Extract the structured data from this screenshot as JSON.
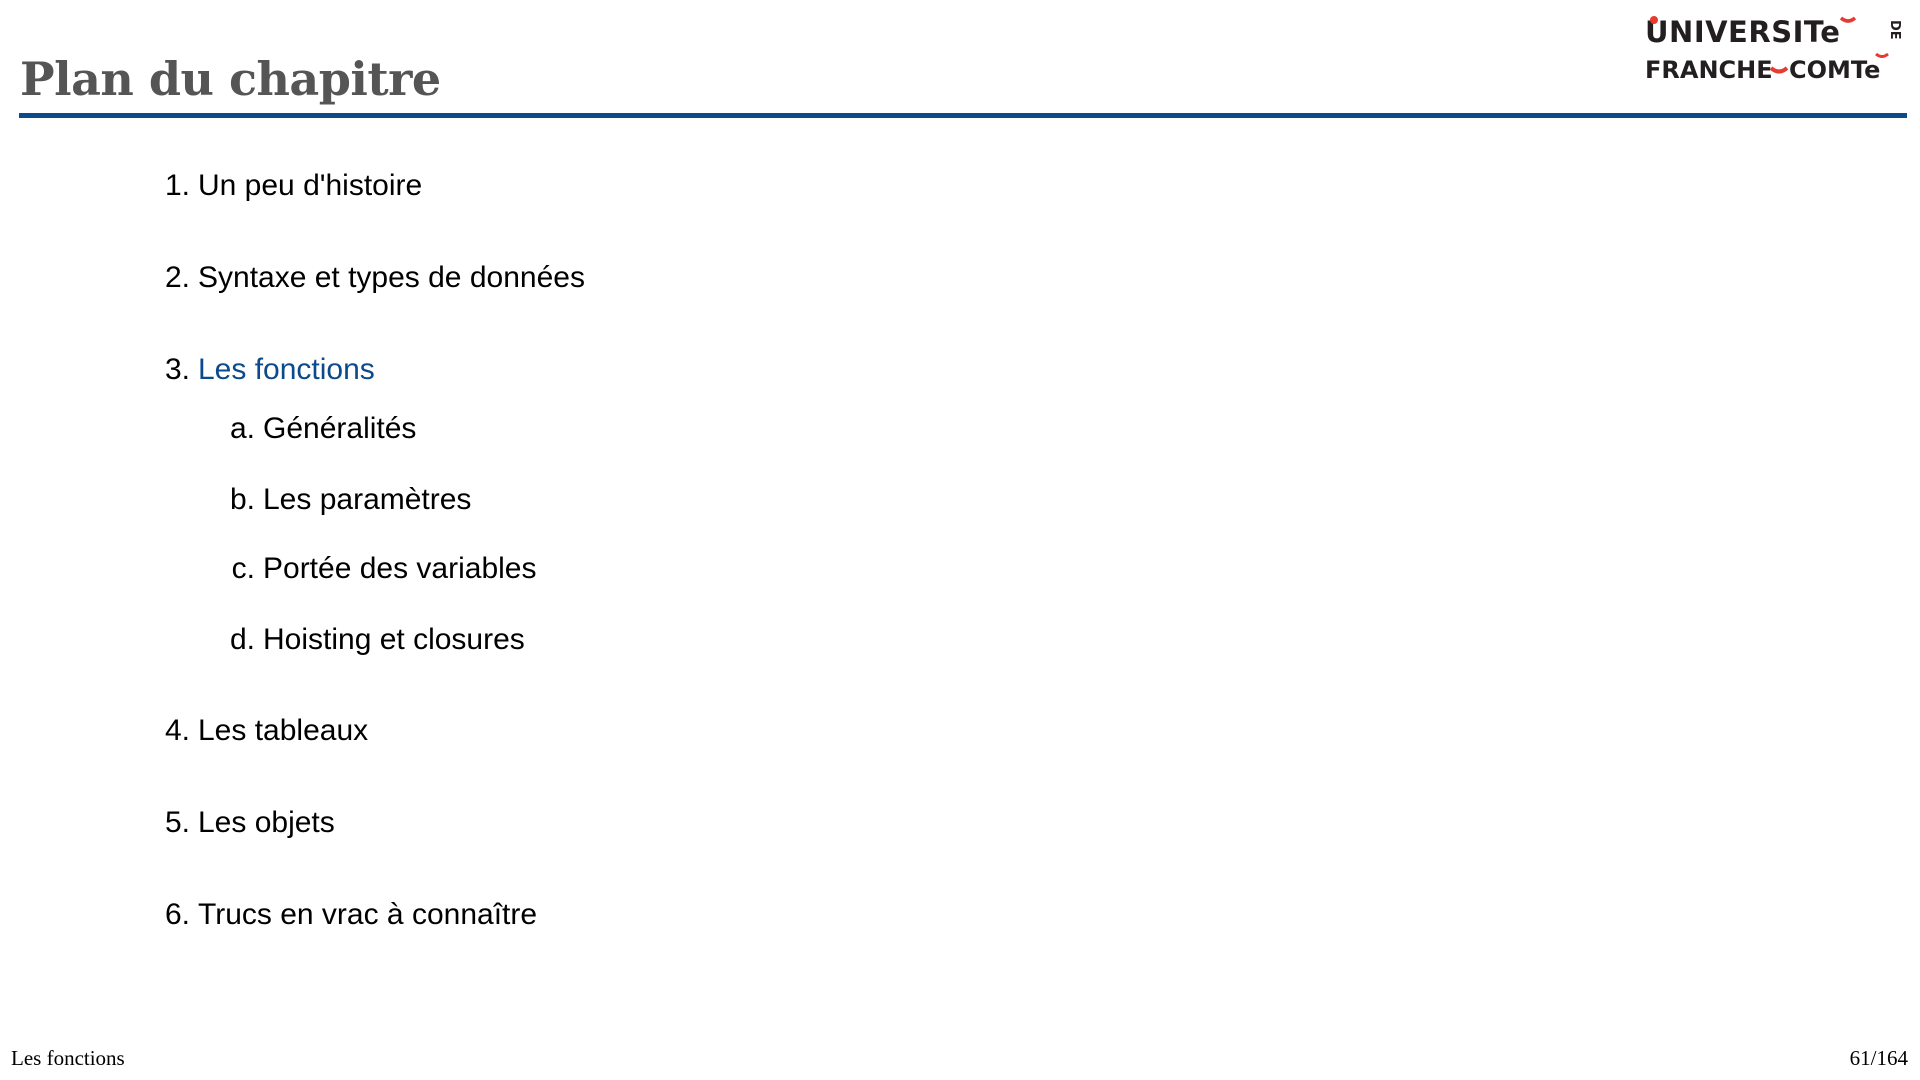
{
  "header": {
    "title": "Plan du chapitre",
    "logo": {
      "line1": "UNIVERSITé",
      "line2": "FRANCHE-COMTé",
      "de": "DE"
    },
    "accent_color": "#0b4a8b"
  },
  "outline": [
    {
      "num": "1.",
      "label": "Un peu d'histoire",
      "level": 1
    },
    {
      "num": "2.",
      "label": "Syntaxe et types de données",
      "level": 1
    },
    {
      "num": "3.",
      "label": "Les fonctions",
      "level": 1,
      "active": true
    },
    {
      "num": "a.",
      "label": "Généralités",
      "level": 2
    },
    {
      "num": "b.",
      "label": "Les paramètres",
      "level": 2
    },
    {
      "num": "c.",
      "label": "Portée des variables",
      "level": 2
    },
    {
      "num": "d.",
      "label": "Hoisting et closures",
      "level": 2
    },
    {
      "num": "4.",
      "label": "Les tableaux",
      "level": 1
    },
    {
      "num": "5.",
      "label": "Les objets",
      "level": 1
    },
    {
      "num": "6.",
      "label": "Trucs en vrac à connaître",
      "level": 1
    }
  ],
  "footer": {
    "section": "Les fonctions",
    "page": "61/164"
  }
}
